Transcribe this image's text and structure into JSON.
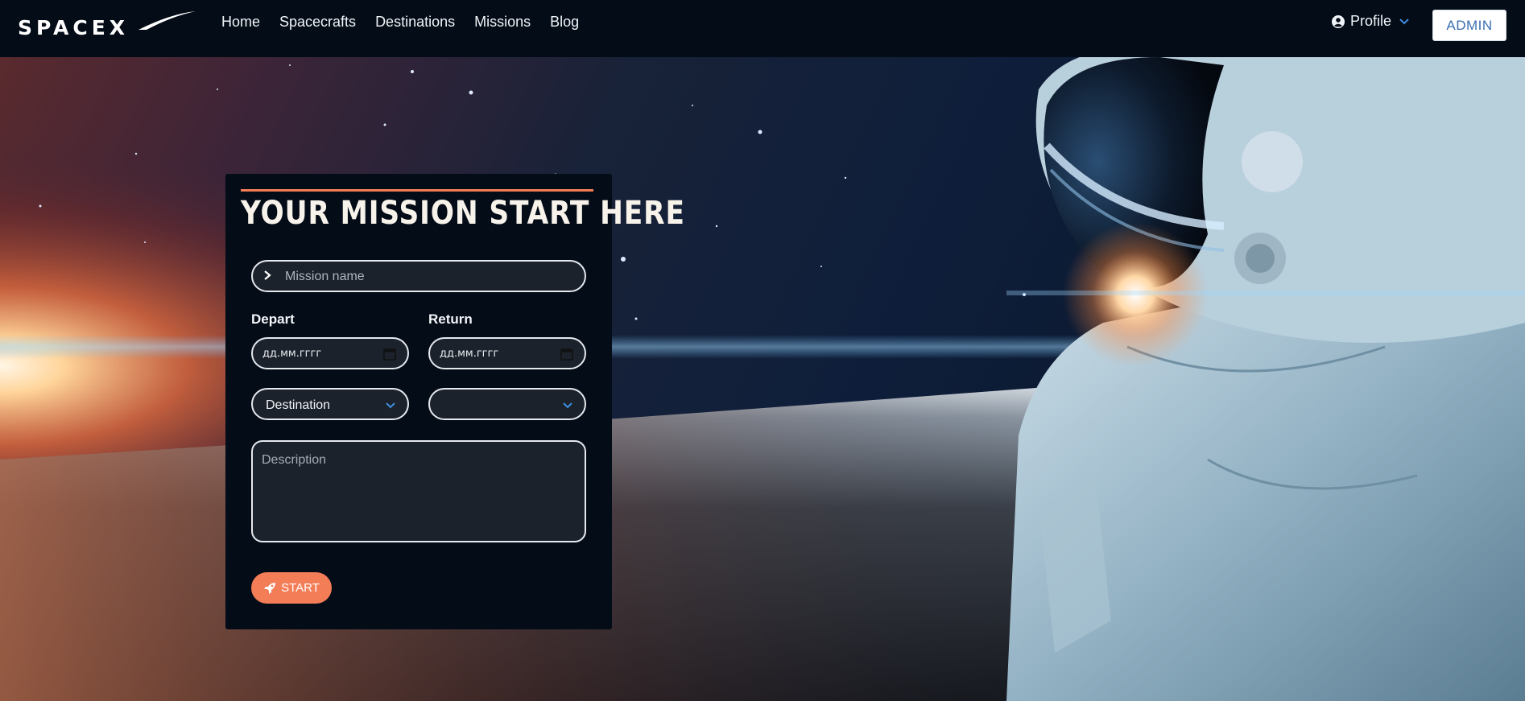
{
  "brand": {
    "logo_text": "SPACEX"
  },
  "nav": {
    "links": [
      "Home",
      "Spacecrafts",
      "Destinations",
      "Missions",
      "Blog"
    ],
    "profile_label": "Profile",
    "admin_label": "ADMIN"
  },
  "mission_form": {
    "title": "YOUR MISSION START HERE",
    "mission_name_placeholder": "Mission name",
    "depart_label": "Depart",
    "return_label": "Return",
    "depart_value": "дд.мм.гггг",
    "return_value": "дд.мм.гггг",
    "destination_value": "Destination",
    "second_select_value": "",
    "description_placeholder": "Description",
    "start_label": "START"
  },
  "colors": {
    "nav_bg": "#040c17",
    "accent": "#f37d57",
    "admin_text": "#3b6fb0",
    "chevron": "#3f8ee0"
  },
  "icons": {
    "profile": "user-circle-icon",
    "profile_dropdown": "chevron-down-icon",
    "mission_name": "chevron-right-icon",
    "date": "calendar-icon",
    "select": "chevron-down-icon",
    "start": "rocket-icon"
  }
}
